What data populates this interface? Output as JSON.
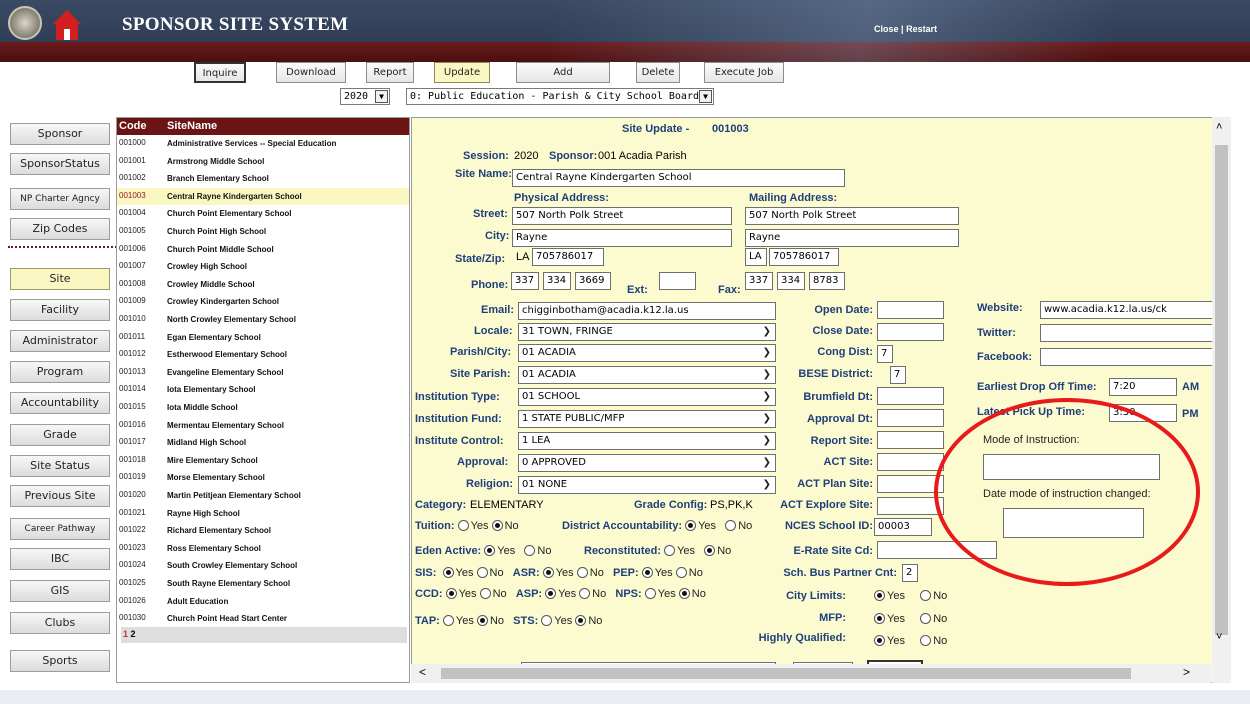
{
  "header": {
    "title": "SPONSOR SITE SYSTEM",
    "close": "Close",
    "sep": "|",
    "restart": "Restart"
  },
  "toolbar": {
    "buttons": [
      "Inquire",
      "Download",
      "Report",
      "Update",
      "Add",
      "Delete",
      "Execute Job"
    ],
    "year": "2020",
    "sponsor_type": "0: Public Education - Parish & City School Boards"
  },
  "nav": [
    "Sponsor",
    "SponsorStatus",
    "NP Charter Agncy",
    "Zip Codes",
    "Site",
    "Facility",
    "Administrator",
    "Program",
    "Accountability",
    "Grade",
    "Site Status",
    "Previous Site",
    "Career Pathway",
    "IBC",
    "GIS",
    "Clubs",
    "Sports"
  ],
  "list": {
    "headers": {
      "code": "Code",
      "name": "SiteName"
    },
    "rows": [
      [
        "001000",
        "Administrative Services -- Special Education"
      ],
      [
        "001001",
        "Armstrong Middle School"
      ],
      [
        "001002",
        "Branch Elementary School"
      ],
      [
        "001003",
        "Central Rayne Kindergarten School"
      ],
      [
        "001004",
        "Church Point Elementary School"
      ],
      [
        "001005",
        "Church Point High School"
      ],
      [
        "001006",
        "Church Point Middle School"
      ],
      [
        "001007",
        "Crowley High School"
      ],
      [
        "001008",
        "Crowley Middle School"
      ],
      [
        "001009",
        "Crowley Kindergarten School"
      ],
      [
        "001010",
        "North Crowley Elementary School"
      ],
      [
        "001011",
        "Egan Elementary School"
      ],
      [
        "001012",
        "Estherwood Elementary School"
      ],
      [
        "001013",
        "Evangeline Elementary School"
      ],
      [
        "001014",
        "Iota Elementary School"
      ],
      [
        "001015",
        "Iota Middle School"
      ],
      [
        "001016",
        "Mermentau Elementary School"
      ],
      [
        "001017",
        "Midland High School"
      ],
      [
        "001018",
        "Mire Elementary School"
      ],
      [
        "001019",
        "Morse Elementary School"
      ],
      [
        "001020",
        "Martin Petitjean Elementary School"
      ],
      [
        "001021",
        "Rayne High School"
      ],
      [
        "001022",
        "Richard Elementary School"
      ],
      [
        "001023",
        "Ross Elementary School"
      ],
      [
        "001024",
        "South Crowley Elementary School"
      ],
      [
        "001025",
        "South Rayne Elementary School"
      ],
      [
        "001026",
        "Adult Education"
      ],
      [
        "001030",
        "Church Point Head Start Center"
      ]
    ],
    "pages": [
      "1",
      "2"
    ]
  },
  "form": {
    "heading": "Site Update -",
    "site_code": "001003",
    "session_label": "Session:",
    "session": "2020",
    "sponsor_label": "Sponsor:",
    "sponsor": "001 Acadia Parish",
    "site_name_label": "Site Name:",
    "site_name": "Central Rayne Kindergarten School",
    "physical_label": "Physical Address:",
    "mailing_label": "Mailing Address:",
    "street_label": "Street:",
    "street": "507 North Polk Street",
    "mail_street": "507 North Polk Street",
    "city_label": "City:",
    "city": "Rayne",
    "mail_city": "Rayne",
    "statezip_label": "State/Zip:",
    "state": "LA",
    "zip": "705786017",
    "mail_state": "LA",
    "mail_zip": "705786017",
    "phone_label": "Phone:",
    "phone": [
      "337",
      "334",
      "3669"
    ],
    "ext_label": "Ext:",
    "ext": "",
    "fax_label": "Fax:",
    "fax": [
      "337",
      "334",
      "8783"
    ],
    "email_label": "Email:",
    "email": "chigginbotham@acadia.k12.la.us",
    "locale_label": "Locale:",
    "locale": "31 TOWN, FRINGE",
    "parish_label": "Parish/City:",
    "parish": "01 ACADIA",
    "site_parish_label": "Site Parish:",
    "site_parish": "01 ACADIA",
    "inst_type_label": "Institution Type:",
    "inst_type": "01 SCHOOL",
    "inst_fund_label": "Institution Fund:",
    "inst_fund": "1 STATE PUBLIC/MFP",
    "inst_control_label": "Institute Control:",
    "inst_control": "1 LEA",
    "approval_label": "Approval:",
    "approval": "0 APPROVED",
    "religion_label": "Religion:",
    "religion": "01 NONE",
    "category_label": "Category:",
    "category": "ELEMENTARY",
    "grade_config_label": "Grade Config:",
    "grade_config": "PS,PK,K",
    "tuition_label": "Tuition:",
    "district_acc_label": "District Accountability:",
    "eden_label": "Eden Active:",
    "reconstituted_label": "Reconstituted:",
    "sis_label": "SIS:",
    "asr_label": "ASR:",
    "pep_label": "PEP:",
    "ccd_label": "CCD:",
    "asp_label": "ASP:",
    "nps_label": "NPS:",
    "tap_label": "TAP:",
    "sts_label": "STS:",
    "yes": "Yes",
    "no": "No",
    "open_date_label": "Open Date:",
    "close_date_label": "Close Date:",
    "cong_dist_label": "Cong Dist:",
    "cong_dist": "7",
    "bese_label": "BESE District:",
    "bese": "7",
    "brumfield_label": "Brumfield Dt:",
    "approval_dt_label": "Approval Dt:",
    "report_site_label": "Report Site:",
    "act_site_label": "ACT Site:",
    "act_plan_label": "ACT Plan Site:",
    "act_explore_label": "ACT Explore Site:",
    "nces_label": "NCES School ID:",
    "nces": "00003",
    "erate_label": "E-Rate Site Cd:",
    "sch_bus_label": "Sch. Bus Partner Cnt:",
    "sch_bus": "2",
    "city_limits_label": "City Limits:",
    "mfp_label": "MFP:",
    "highly_label": "Highly Qualified:",
    "website_label": "Website:",
    "website": "www.acadia.k12.la.us/ck",
    "twitter_label": "Twitter:",
    "facebook_label": "Facebook:",
    "drop_off_label": "Earliest Drop Off Time:",
    "drop_off": "7:20",
    "am": "AM",
    "pick_up_label": "Latest Pick Up Time:",
    "pick_up": "3:30",
    "pm": "PM",
    "mode_label": "Mode of Instruction:",
    "mode_changed_label": "Date mode of instruction changed:"
  },
  "colors": {
    "header": "#2b3850",
    "accent_red": "#6b1414",
    "panel": "#fcfbd0",
    "highlight": "#fbf7c2",
    "circle": "#e81b1b"
  }
}
